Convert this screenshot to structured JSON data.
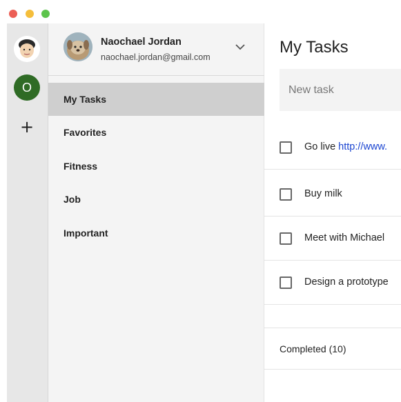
{
  "window": {
    "controls": [
      "close",
      "minimize",
      "maximize"
    ],
    "colors": {
      "close": "#ec5f56",
      "minimize": "#f5be3b",
      "maximize": "#5cc44b"
    }
  },
  "rail": {
    "accounts": [
      {
        "icon": "memoji-avatar"
      },
      {
        "initial": "O",
        "color": "#2f6b25"
      }
    ],
    "add_label": "+"
  },
  "account": {
    "name": "Naochael Jordan",
    "email": "naochael.jordan@gmail.com"
  },
  "lists": [
    {
      "label": "My Tasks",
      "active": true
    },
    {
      "label": "Favorites",
      "active": false
    },
    {
      "label": "Fitness",
      "active": false
    },
    {
      "label": "Job",
      "active": false
    },
    {
      "label": "Important",
      "active": false
    }
  ],
  "main": {
    "title": "My Tasks",
    "new_task_placeholder": "New task",
    "tasks": [
      {
        "text": "Go live ",
        "link": "http://www.",
        "checked": false
      },
      {
        "text": "Buy milk",
        "checked": false
      },
      {
        "text": "Meet with Michael",
        "checked": false
      },
      {
        "text": "Design a prototype",
        "checked": false
      }
    ],
    "completed_label": "Completed (10)"
  }
}
